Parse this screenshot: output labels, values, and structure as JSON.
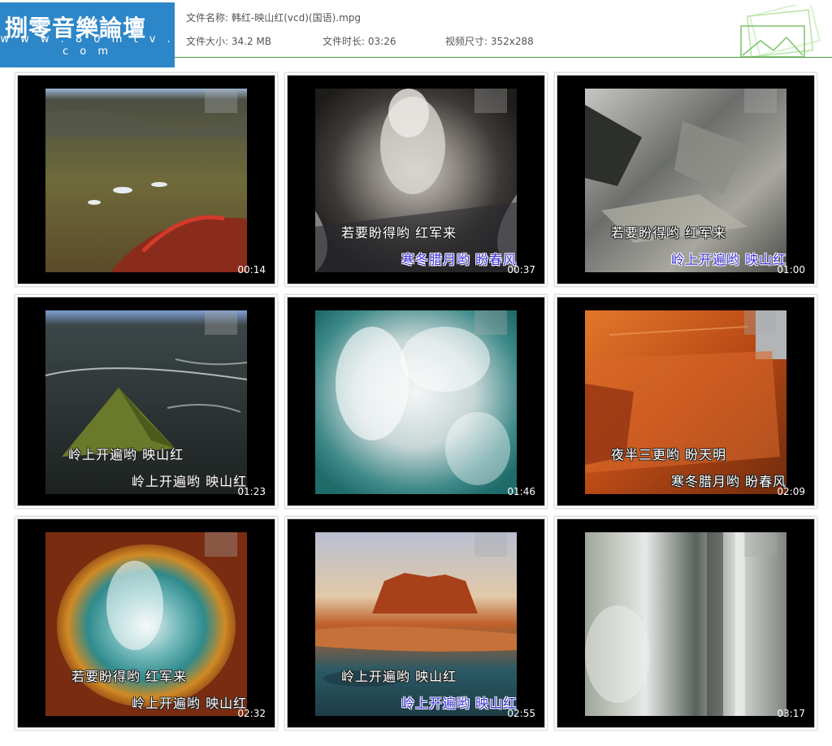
{
  "header": {
    "logo_title": "捌零音樂論壇",
    "logo_url": "w w w . 8 0 m t v . c o m",
    "file_name_label": "文件名称:",
    "file_name": "韩红-映山红(vcd)(国语).mpg",
    "file_size_label": "文件大小:",
    "file_size": "34.2 MB",
    "duration_label": "文件时长:",
    "duration": "03:26",
    "resolution_label": "视频尺寸:",
    "resolution": "352x288"
  },
  "thumbnails": [
    {
      "time": "00:14",
      "scene": "volcanic-plain",
      "lyric1": "",
      "lyric2": ""
    },
    {
      "time": "00:37",
      "scene": "volcano-crater-steam",
      "lyric1": "若要盼得哟  红军来",
      "lyric2": "寒冬腊月哟  盼春风"
    },
    {
      "time": "01:00",
      "scene": "rock-cliffs",
      "lyric1": "若要盼得哟  红军来",
      "lyric2": "岭上开遍哟  映山红"
    },
    {
      "time": "01:23",
      "scene": "green-volcanic-cone",
      "lyric1": "岭上开遍哟  映山红",
      "lyric2": "岭上开遍哟  映山红"
    },
    {
      "time": "01:46",
      "scene": "clouds-over-sea",
      "lyric1": "",
      "lyric2": ""
    },
    {
      "time": "02:09",
      "scene": "red-canyon-cliff",
      "lyric1": "夜半三更哟  盼天明",
      "lyric2": "寒冬腊月哟  盼春风"
    },
    {
      "time": "02:32",
      "scene": "hot-spring",
      "lyric1": "若要盼得哟  红军来",
      "lyric2": "岭上开遍哟  映山红"
    },
    {
      "time": "02:55",
      "scene": "desert-mesa-lake",
      "lyric1": "岭上开遍哟  映山红",
      "lyric2": "岭上开遍哟  映山红"
    },
    {
      "time": "03:17",
      "scene": "waterfall",
      "lyric1": "",
      "lyric2": ""
    }
  ]
}
